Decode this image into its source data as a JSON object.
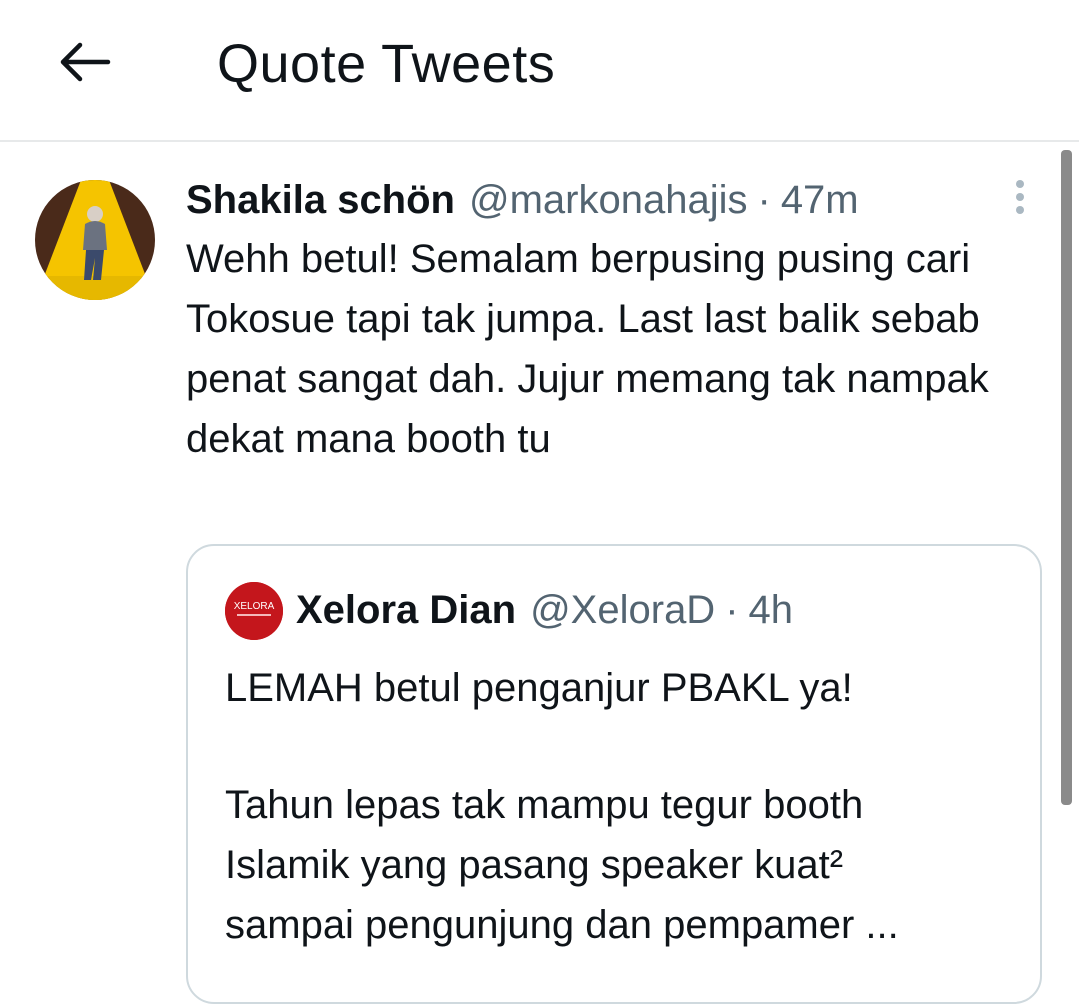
{
  "header": {
    "title": "Quote Tweets",
    "back_icon": "arrow-left-icon"
  },
  "tweet": {
    "author_name": "Shakila schön",
    "handle": "@markonahajis",
    "separator": "·",
    "time": "47m",
    "text": "Wehh betul! Semalam berpusing pusing cari Tokosue tapi tak jumpa. Last last balik sebab penat sangat dah. Jujur memang tak nampak dekat mana booth tu",
    "avatar_icon": "user-avatar",
    "more_icon": "more-vertical-icon"
  },
  "quoted": {
    "author_name": "Xelora Dian",
    "handle": "@XeloraD",
    "separator": "·",
    "time": "4h",
    "avatar_logo_text": "XELORA",
    "line1": "LEMAH betul penganjur PBAKL ya!",
    "line2": "Tahun lepas tak mampu tegur booth",
    "line3": "Islamik yang pasang speaker kuat²",
    "line4": "sampai pengunjung dan pempamer ..."
  },
  "colors": {
    "text_primary": "#0f1419",
    "text_secondary": "#536471",
    "border": "#cfd9de",
    "quote_avatar_bg": "#c4161c",
    "avatar_yellow": "#f5c400"
  }
}
